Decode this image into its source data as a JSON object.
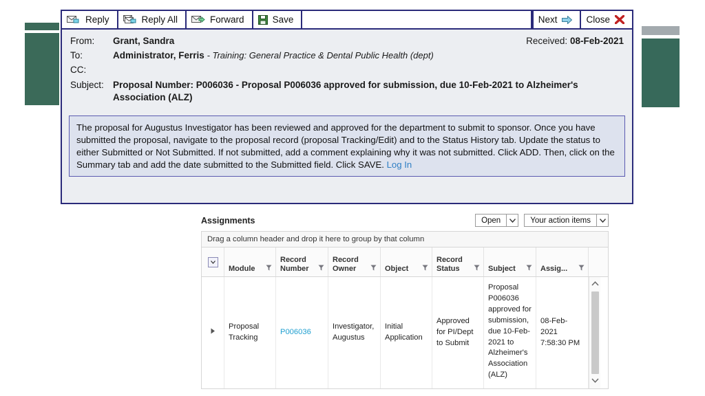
{
  "decor": {
    "left_accent_color": "#3b6a59",
    "right_bar_color": "#a3aaae",
    "right_block_color": "#37695a"
  },
  "email": {
    "border_color": "#2a2a7a",
    "toolbar": {
      "buttons": [
        {
          "label": "Reply",
          "icon": "reply-envelope-icon"
        },
        {
          "label": "Reply All",
          "icon": "reply-all-envelope-icon"
        },
        {
          "label": "Forward",
          "icon": "forward-envelope-icon"
        },
        {
          "label": "Save",
          "icon": "floppy-disk-icon"
        }
      ],
      "right_buttons": [
        {
          "label": "Next",
          "icon": "next-arrow-icon"
        },
        {
          "label": "Close",
          "icon": "close-x-icon"
        }
      ]
    },
    "fields": {
      "from_label": "From:",
      "from_value": "Grant, Sandra",
      "received_label": "Received:",
      "received_value": "08-Feb-2021",
      "to_label": "To:",
      "to_value": "Administrator, Ferris",
      "to_dept": "- Training: General Practice & Dental Public Health (dept)",
      "cc_label": "CC:",
      "cc_value": "",
      "subject_label": "Subject:",
      "subject_value": "Proposal Number: P006036 - Proposal P006036 approved for submission, due 10-Feb-2021 to Alzheimer's Association (ALZ)"
    },
    "body": {
      "text": "The proposal for Augustus Investigator has been reviewed and approved for the department to submit to sponsor. Once you have submitted the proposal, navigate to the proposal record (proposal Tracking/Edit) and to the Status History tab. Update the status to either Submitted or Not Submitted. If not submitted, add a comment explaining why it was not submitted. Click ADD. Then, click on the Summary tab and add the date submitted to the Submitted field. Click SAVE.",
      "link_label": "Log In",
      "link_color": "#2f7fc4",
      "background_color": "#dde2ee",
      "border_color": "#5a5ab0"
    }
  },
  "assignments": {
    "title": "Assignments",
    "filters": [
      {
        "name": "status-filter",
        "value": "Open"
      },
      {
        "name": "scope-filter",
        "value": "Your action items"
      }
    ],
    "group_bar_text": "Drag a column header and drop it here to group by that column",
    "columns": [
      {
        "key": "checkbox",
        "label": "",
        "filterable": false
      },
      {
        "key": "module",
        "label": "Module",
        "filterable": true
      },
      {
        "key": "record_number",
        "label": "Record Number",
        "filterable": true
      },
      {
        "key": "record_owner",
        "label": "Record Owner",
        "filterable": true
      },
      {
        "key": "object",
        "label": "Object",
        "filterable": true
      },
      {
        "key": "record_status",
        "label": "Record Status",
        "filterable": true
      },
      {
        "key": "subject",
        "label": "Subject",
        "filterable": true
      },
      {
        "key": "assigned",
        "label": "Assig...",
        "filterable": true
      }
    ],
    "rows": [
      {
        "module": "Proposal Tracking",
        "record_number": "P006036",
        "record_owner": "Investigator, Augustus",
        "object": "Initial Application",
        "record_status": "Approved for PI/Dept to Submit",
        "subject": "Proposal P006036 approved for submission, due 10-Feb-2021 to Alzheimer's Association (ALZ)",
        "assigned": "08-Feb-2021 7:58:30 PM"
      }
    ],
    "link_color": "#1f9fd0"
  }
}
